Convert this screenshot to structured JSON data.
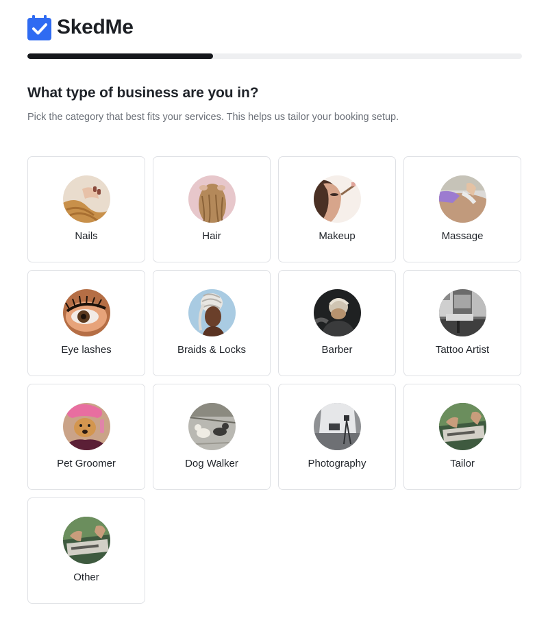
{
  "app": {
    "name": "SkedMe",
    "logo_icon": "calendar-check-icon",
    "accent": "#2f6bf2"
  },
  "progress": {
    "fraction": 0.375
  },
  "header": {
    "title": "What type of business are you in?",
    "subtitle": "Pick the category that best fits your services. This helps us tailor your booking setup."
  },
  "categories": [
    {
      "label": "Nails",
      "image": "nails-photo"
    },
    {
      "label": "Hair",
      "image": "hair-photo"
    },
    {
      "label": "Makeup",
      "image": "makeup-photo"
    },
    {
      "label": "Massage",
      "image": "massage-photo"
    },
    {
      "label": "Eye lashes",
      "image": "eye-lashes-photo"
    },
    {
      "label": "Braids & Locks",
      "image": "braids-photo"
    },
    {
      "label": "Barber",
      "image": "barber-photo"
    },
    {
      "label": "Tattoo Artist",
      "image": "tattoo-studio-photo"
    },
    {
      "label": "Pet Groomer",
      "image": "pet-groomer-photo"
    },
    {
      "label": "Dog Walker",
      "image": "dog-walker-photo"
    },
    {
      "label": "Photography",
      "image": "photography-studio-photo"
    },
    {
      "label": "Tailor",
      "image": "tailor-sewing-photo"
    },
    {
      "label": "Other",
      "image": "other-sewing-photo"
    }
  ]
}
